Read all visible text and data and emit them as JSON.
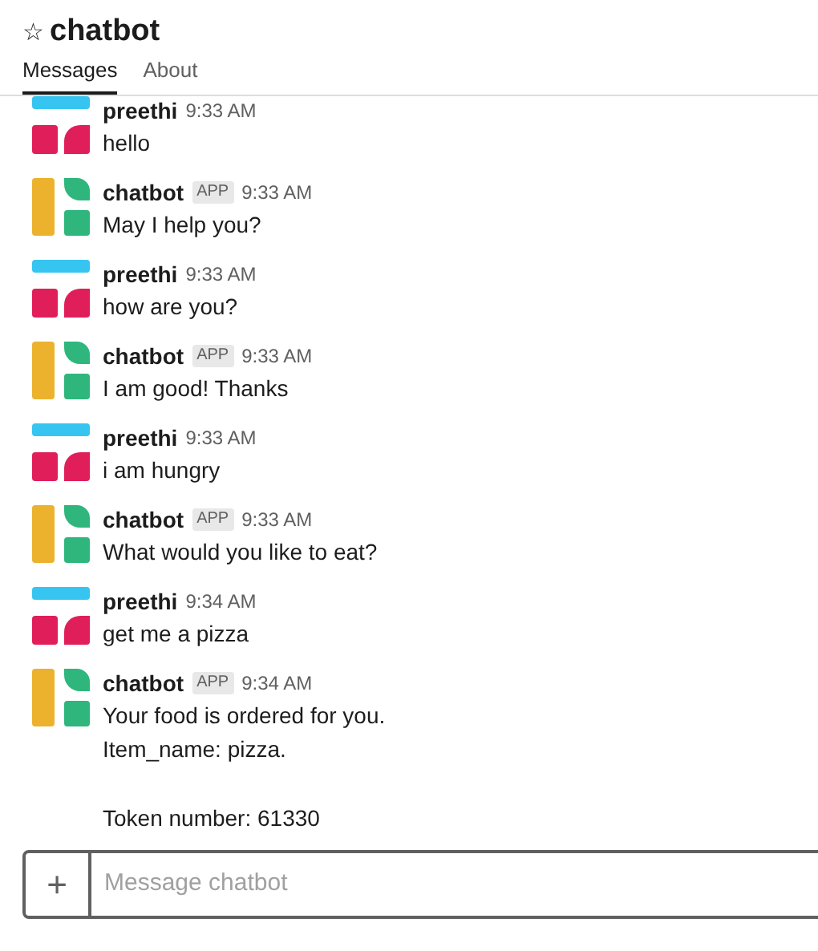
{
  "header": {
    "star": "☆",
    "title": "chatbot",
    "tabs": [
      {
        "label": "Messages",
        "selected": true
      },
      {
        "label": "About",
        "selected": false
      }
    ]
  },
  "messages": [
    {
      "kind": "user",
      "name": "preethi",
      "time": "9:33 AM",
      "paragraphs": [
        [
          "hello"
        ]
      ]
    },
    {
      "kind": "bot",
      "name": "chatbot",
      "badge": "APP",
      "time": "9:33 AM",
      "paragraphs": [
        [
          "May I help you?"
        ]
      ]
    },
    {
      "kind": "user",
      "name": "preethi",
      "time": "9:33 AM",
      "paragraphs": [
        [
          "how are you?"
        ]
      ]
    },
    {
      "kind": "bot",
      "name": "chatbot",
      "badge": "APP",
      "time": "9:33 AM",
      "paragraphs": [
        [
          "I am good! Thanks"
        ]
      ]
    },
    {
      "kind": "user",
      "name": "preethi",
      "time": "9:33 AM",
      "paragraphs": [
        [
          "i am hungry"
        ]
      ]
    },
    {
      "kind": "bot",
      "name": "chatbot",
      "badge": "APP",
      "time": "9:33 AM",
      "paragraphs": [
        [
          "What would you like to eat?"
        ]
      ]
    },
    {
      "kind": "user",
      "name": "preethi",
      "time": "9:34 AM",
      "paragraphs": [
        [
          "get me a pizza"
        ]
      ]
    },
    {
      "kind": "bot",
      "name": "chatbot",
      "badge": "APP",
      "time": "9:34 AM",
      "paragraphs": [
        [
          "Your food is ordered for you.",
          "Item_name: pizza."
        ],
        [
          "Token number: 61330"
        ]
      ]
    }
  ],
  "composer": {
    "button": "+",
    "placeholder": "Message chatbot"
  }
}
